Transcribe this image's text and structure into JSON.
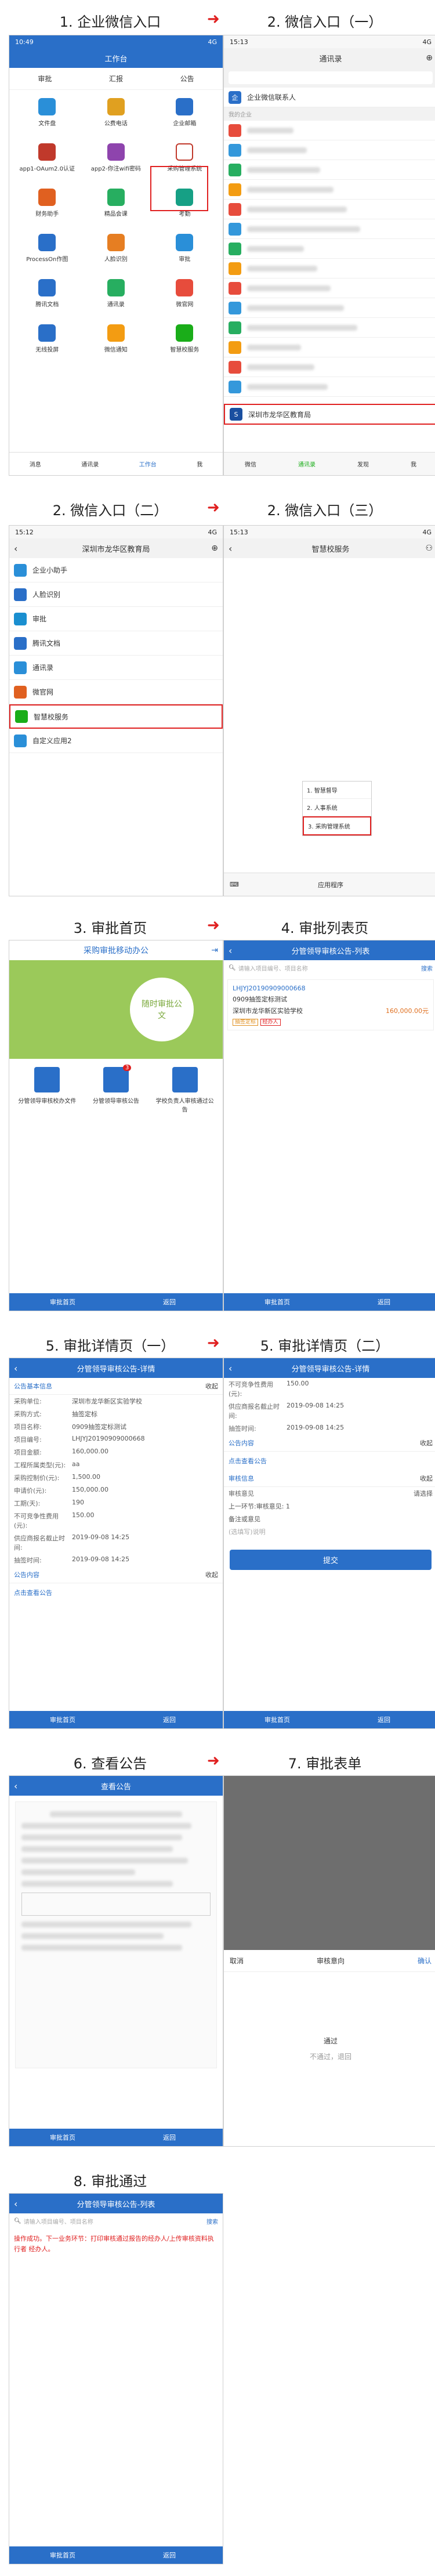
{
  "captions": [
    "1. 企业微信入口",
    "2. 微信入口（一）",
    "2. 微信入口（二）",
    "2. 微信入口（三）",
    "3. 审批首页",
    "4. 审批列表页",
    "5. 审批详情页（一）",
    "5. 审批详情页（二）",
    "6. 查看公告",
    "7. 审批表单",
    "8. 审批通过"
  ],
  "status": {
    "time1": "10:49",
    "time2": "15:13",
    "time3": "15:12",
    "time4": "15:13",
    "net": "4G"
  },
  "s1": {
    "title": "工作台",
    "tabs": [
      "审批",
      "汇报",
      "公告"
    ],
    "apps": [
      "文件盘",
      "公费电话",
      "企业邮箱",
      "app1-OAum2.0认证",
      "app2-你注wifi密码",
      "采购管理系统",
      "财务助手",
      "精品会课",
      "考勤",
      "ProcessOn作图",
      "人脸识别",
      "审批",
      "腾讯文档",
      "通讯录",
      "微官网",
      "无线投屏",
      "微信通知",
      "智慧校服务"
    ],
    "bottom": [
      "消息",
      "通讯录",
      "工作台",
      "我"
    ]
  },
  "s2": {
    "title": "通讯录",
    "item1": "企业微信联系人",
    "label": "我的企业",
    "hl": "深圳市龙华区教育局",
    "bottom": [
      "微信",
      "通讯录",
      "发现",
      "我"
    ]
  },
  "s3": {
    "title": "深圳市龙华区教育局",
    "items": [
      "企业小助手",
      "人脸识别",
      "审批",
      "腾讯文档",
      "通讯录",
      "微官网",
      "智慧校服务",
      "自定义应用2"
    ]
  },
  "s4": {
    "title": "智慧校服务",
    "menu": [
      "1. 智慧督导",
      "2. 人事系统",
      "3. 采购管理系统"
    ],
    "appbtn": "应用程序"
  },
  "s5": {
    "title": "采购审批移动办公",
    "banner": "随时审批公文",
    "cards": [
      "分管领导审核校办文件",
      "分管领导审核公告",
      "学校负责人审核通过公告"
    ],
    "badge": "3",
    "nav": [
      "审批首页",
      "返回"
    ]
  },
  "s6": {
    "title": "分管领导审核公告-列表",
    "search": "请输入项目编号、项目名称",
    "sbtn": "搜索",
    "code": "LHJYJ20190909000668",
    "name": "0909抽签定标测试",
    "org": "深圳市龙华新区实验学校",
    "amount": "160,000.00元",
    "tags": [
      "抽签定标",
      "经办人"
    ]
  },
  "s7": {
    "title": "分管领导审核公告-详情",
    "sec1": "公告基本信息",
    "fold": "收起",
    "fields": [
      [
        "采购单位:",
        "深圳市龙华新区实验学校"
      ],
      [
        "采购方式:",
        "抽签定标"
      ],
      [
        "项目名称:",
        "0909抽签定标测试"
      ],
      [
        "项目编号:",
        "LHJYJ20190909000668"
      ],
      [
        "项目金额:",
        "160,000.00"
      ],
      [
        "工程所属类型(元):",
        "aa"
      ],
      [
        "采购控制价(元):",
        "1,500.00"
      ],
      [
        "申请价(元):",
        "150,000.00"
      ],
      [
        "工期(天):",
        "190"
      ],
      [
        "不可竞争性费用(元):",
        "150.00"
      ],
      [
        "供应商报名截止时间:",
        "2019-09-08 14:25"
      ],
      [
        "抽签时间:",
        "2019-09-08 14:25"
      ]
    ],
    "sec2": "公告内容",
    "link": "点击查看公告"
  },
  "s8": {
    "fields": [
      [
        "不可竞争性费用(元):",
        "150.00"
      ],
      [
        "供应商报名截止时间:",
        "2019-09-08 14:25"
      ],
      [
        "抽签时间:",
        "2019-09-08 14:25"
      ]
    ],
    "sec2": "公告内容",
    "link": "点击查看公告",
    "sec3": "审核信息",
    "opinion": "审核意见",
    "choose": "请选择",
    "prev": "上一环节:审核意见: 1",
    "remark": "备注或意见",
    "ph": "(选填写)说明",
    "submit": "提交"
  },
  "s9": {
    "title": "查看公告"
  },
  "s10": {
    "cancel": "取消",
    "head": "审核意向",
    "ok": "确认",
    "opt1": "通过",
    "opt2": "不通过，退回"
  },
  "s11": {
    "msg": "操作成功。下一业务环节：打印审核通过报告的经办人/上传审核资料执行者 经办人。"
  }
}
